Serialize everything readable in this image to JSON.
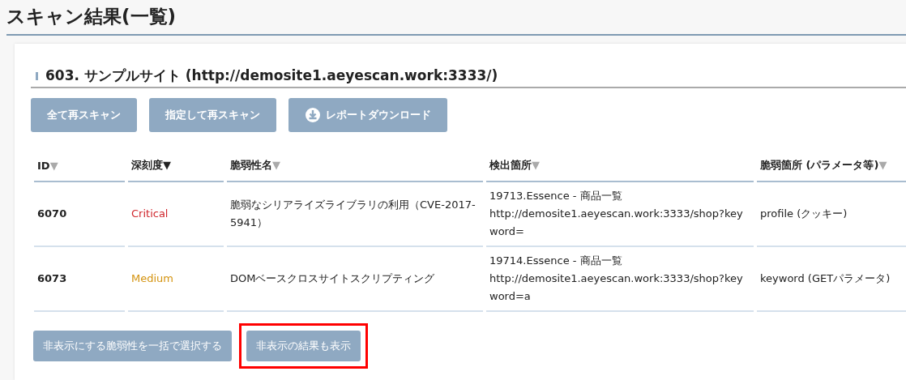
{
  "page_title": "スキャン結果(一覧)",
  "site": {
    "title": "603. サンプルサイト (http://demosite1.aeyescan.work:3333/)"
  },
  "actions": [
    {
      "label": "全て再スキャン",
      "kind": "plain"
    },
    {
      "label": "指定して再スキャン",
      "kind": "plain"
    },
    {
      "label": "レポートダウンロード",
      "kind": "download"
    }
  ],
  "table": {
    "columns": [
      {
        "label": "ID",
        "sort_mark": "▼",
        "sorted": false
      },
      {
        "label": "深刻度",
        "sort_mark": "▼",
        "sorted": true
      },
      {
        "label": "脆弱性名",
        "sort_mark": "▼",
        "sorted": false
      },
      {
        "label": "検出箇所",
        "sort_mark": "▼",
        "sorted": false
      },
      {
        "label": "脆弱箇所 (パラメータ等)",
        "sort_mark": "▼",
        "sorted": false
      }
    ],
    "rows": [
      {
        "id": "6070",
        "severity": "Critical",
        "color": "#d0262c",
        "name": "脆弱なシリアライズライブラリの利用（CVE-2017-5941）",
        "location_title": "19713.Essence - 商品一覧",
        "location_url": "http://demosite1.aeyescan.work:3333/shop?keyword=",
        "parameter": "profile (クッキー)"
      },
      {
        "id": "6073",
        "severity": "Medium",
        "color": "#d4930f",
        "name": "DOMベースクロスサイトスクリプティング",
        "location_title": "19714.Essence - 商品一覧",
        "location_url": "http://demosite1.aeyescan.work:3333/shop?keyword=a",
        "parameter": "keyword (GETパラメータ)"
      }
    ]
  },
  "footer_buttons": [
    {
      "label": "非表示にする脆弱性を一括で選択する",
      "highlighted": false
    },
    {
      "label": "非表示の結果も表示",
      "highlighted": true
    }
  ]
}
